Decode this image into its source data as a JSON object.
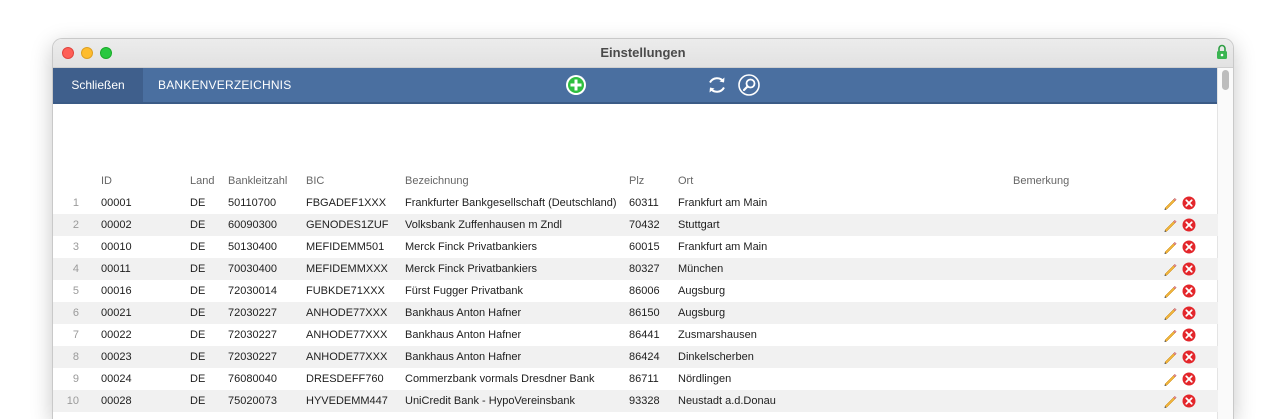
{
  "window": {
    "title": "Einstellungen"
  },
  "toolbar": {
    "close_label": "Schließen",
    "title": "BANKENVERZEICHNIS",
    "add_icon": "plus-circle-icon",
    "refresh_icon": "refresh-icon",
    "search_icon": "search-icon"
  },
  "table": {
    "columns": {
      "id": "ID",
      "land": "Land",
      "blz": "Bankleitzahl",
      "bic": "BIC",
      "bezeichnung": "Bezeichnung",
      "plz": "Plz",
      "ort": "Ort",
      "bemerkung": "Bemerkung"
    },
    "rows": [
      {
        "num": "1",
        "id": "00001",
        "land": "DE",
        "blz": "50110700",
        "bic": "FBGADEF1XXX",
        "bezeichnung": "Frankfurter Bankgesellschaft (Deutschland)",
        "plz": "60311",
        "ort": "Frankfurt am Main",
        "bemerkung": ""
      },
      {
        "num": "2",
        "id": "00002",
        "land": "DE",
        "blz": "60090300",
        "bic": "GENODES1ZUF",
        "bezeichnung": "Volksbank Zuffenhausen m Zndl",
        "plz": "70432",
        "ort": "Stuttgart",
        "bemerkung": ""
      },
      {
        "num": "3",
        "id": "00010",
        "land": "DE",
        "blz": "50130400",
        "bic": "MEFIDEMM501",
        "bezeichnung": "Merck Finck Privatbankiers",
        "plz": "60015",
        "ort": "Frankfurt am Main",
        "bemerkung": ""
      },
      {
        "num": "4",
        "id": "00011",
        "land": "DE",
        "blz": "70030400",
        "bic": "MEFIDEMMXXX",
        "bezeichnung": "Merck Finck Privatbankiers",
        "plz": "80327",
        "ort": "München",
        "bemerkung": ""
      },
      {
        "num": "5",
        "id": "00016",
        "land": "DE",
        "blz": "72030014",
        "bic": "FUBKDE71XXX",
        "bezeichnung": "Fürst Fugger Privatbank",
        "plz": "86006",
        "ort": "Augsburg",
        "bemerkung": ""
      },
      {
        "num": "6",
        "id": "00021",
        "land": "DE",
        "blz": "72030227",
        "bic": "ANHODE77XXX",
        "bezeichnung": "Bankhaus Anton Hafner",
        "plz": "86150",
        "ort": "Augsburg",
        "bemerkung": ""
      },
      {
        "num": "7",
        "id": "00022",
        "land": "DE",
        "blz": "72030227",
        "bic": "ANHODE77XXX",
        "bezeichnung": "Bankhaus Anton Hafner",
        "plz": "86441",
        "ort": "Zusmarshausen",
        "bemerkung": ""
      },
      {
        "num": "8",
        "id": "00023",
        "land": "DE",
        "blz": "72030227",
        "bic": "ANHODE77XXX",
        "bezeichnung": "Bankhaus Anton Hafner",
        "plz": "86424",
        "ort": "Dinkelscherben",
        "bemerkung": ""
      },
      {
        "num": "9",
        "id": "00024",
        "land": "DE",
        "blz": "76080040",
        "bic": "DRESDEFF760",
        "bezeichnung": "Commerzbank vormals Dresdner Bank",
        "plz": "86711",
        "ort": "Nördlingen",
        "bemerkung": ""
      },
      {
        "num": "10",
        "id": "00028",
        "land": "DE",
        "blz": "75020073",
        "bic": "HYVEDEMM447",
        "bezeichnung": "UniCredit Bank - HypoVereinsbank",
        "plz": "93328",
        "ort": "Neustadt a.d.Donau",
        "bemerkung": ""
      }
    ]
  },
  "colors": {
    "toolbar_bg": "#4a6fa0",
    "close_bg": "#3f5f8c",
    "add_green": "#2fbf3f",
    "delete_red": "#e3262b",
    "row_alt": "#f1f1f1"
  }
}
